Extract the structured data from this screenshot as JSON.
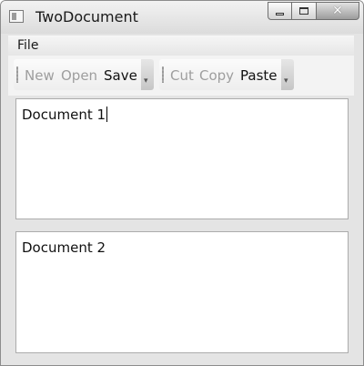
{
  "window": {
    "title": "TwoDocument"
  },
  "menu": {
    "items": [
      "File"
    ]
  },
  "toolbars": [
    {
      "buttons": [
        {
          "label": "New",
          "enabled": false
        },
        {
          "label": "Open",
          "enabled": false
        },
        {
          "label": "Save",
          "enabled": true
        }
      ]
    },
    {
      "buttons": [
        {
          "label": "Cut",
          "enabled": false
        },
        {
          "label": "Copy",
          "enabled": false
        },
        {
          "label": "Paste",
          "enabled": true
        }
      ]
    }
  ],
  "documents": [
    {
      "text": "Document 1",
      "focused": true
    },
    {
      "text": "Document 2",
      "focused": false
    }
  ],
  "icons": {
    "app": "app-window-icon",
    "minimize": "minimize-icon",
    "maximize": "maximize-icon",
    "close": "close-icon",
    "overflow": "chevron-down-icon"
  }
}
